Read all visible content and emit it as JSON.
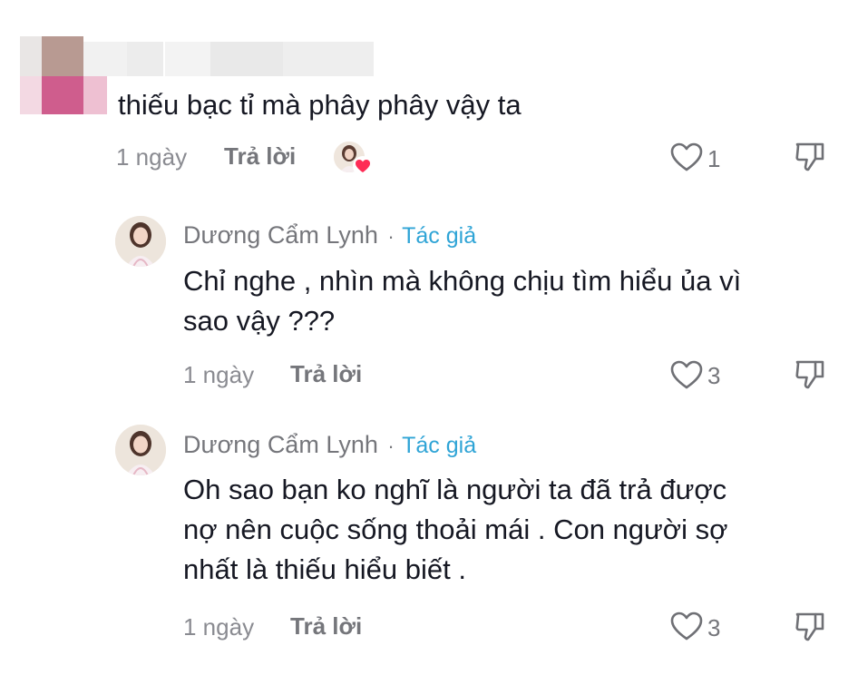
{
  "top_comment": {
    "text": "thiếu bạc tỉ mà phây phây vậy ta",
    "time": "1 ngày",
    "reply_label": "Trả lời",
    "like_count": "1"
  },
  "replies": [
    {
      "author": "Dương Cẩm Lynh",
      "separator": "·",
      "badge": "Tác giả",
      "lines": [
        "Chỉ nghe , nhìn mà không chịu tìm hiểu ủa vì",
        "sao vậy ???"
      ],
      "time": "1 ngày",
      "reply_label": "Trả lời",
      "like_count": "3"
    },
    {
      "author": "Dương Cẩm Lynh",
      "separator": "·",
      "badge": "Tác giả",
      "lines": [
        "Oh sao bạn ko nghĩ là người ta đã trả được",
        "nợ nên cuộc sống thoải mái . Con người sợ",
        "nhất là thiếu hiểu biết ."
      ],
      "time": "1 ngày",
      "reply_label": "Trả lời",
      "like_count": "3"
    }
  ],
  "colors": {
    "text": "#161823",
    "muted": "#8a8b91",
    "author_badge": "#2fa4d6",
    "creator_heart": "#fe2c55"
  },
  "icons": [
    "heart-outline-icon",
    "thumbs-down-icon",
    "creator-liked-heart-icon"
  ]
}
